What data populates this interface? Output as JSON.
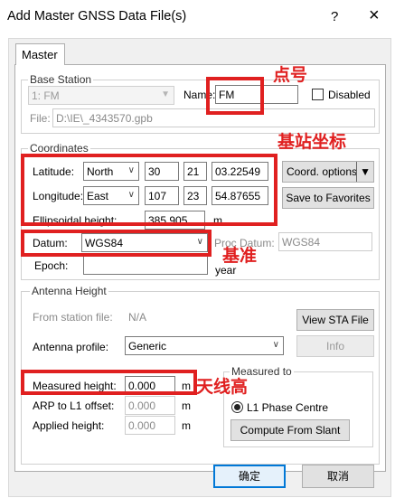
{
  "window": {
    "title": "Add Master GNSS Data File(s)",
    "help": "?",
    "close": "×"
  },
  "tab": "Master",
  "base_station": {
    "legend": "Base Station",
    "station_select": "1: FM",
    "name_label": "Name:",
    "name_value": "FM",
    "disabled_label": "Disabled",
    "file_label": "File:",
    "file_value": "D:\\IE\\_4343570.gpb"
  },
  "coordinates": {
    "legend": "Coordinates",
    "latitude_label": "Latitude:",
    "latitude_hemi": "North",
    "latitude_deg": "30",
    "latitude_min": "21",
    "latitude_sec": "03.22549",
    "longitude_label": "Longitude:",
    "longitude_hemi": "East",
    "longitude_deg": "107",
    "longitude_min": "23",
    "longitude_sec": "54.87655",
    "height_label": "Ellipsoidal height:",
    "height_value": "385.905",
    "height_unit": "m",
    "coord_options": "Coord. options",
    "save_favorites": "Save to Favorites",
    "datum_label": "Datum:",
    "datum_value": "WGS84",
    "proc_datum_label": "Proc Datum:",
    "proc_datum_value": "WGS84",
    "epoch_label": "Epoch:",
    "epoch_unit": "year"
  },
  "antenna": {
    "legend": "Antenna Height",
    "from_file_label": "From station file:",
    "from_file_value": "N/A",
    "view_sta": "View STA File",
    "profile_label": "Antenna profile:",
    "profile_value": "Generic",
    "info": "Info",
    "measured_label": "Measured height:",
    "measured_value": "0.000",
    "arp_label": "ARP to L1 offset:",
    "arp_value": "0.000",
    "applied_label": "Applied height:",
    "applied_value": "0.000",
    "unit": "m",
    "measured_to_legend": "Measured to",
    "l1_phase": "L1 Phase Centre",
    "compute_slant": "Compute From Slant"
  },
  "footer": {
    "ok": "确定",
    "cancel": "取消"
  },
  "annotations": {
    "point_number": "点号",
    "base_coords": "基站坐标",
    "datum": "基准",
    "antenna_height": "天线高"
  },
  "colors": {
    "annotation": "#e02020",
    "accent": "#0078d7"
  }
}
